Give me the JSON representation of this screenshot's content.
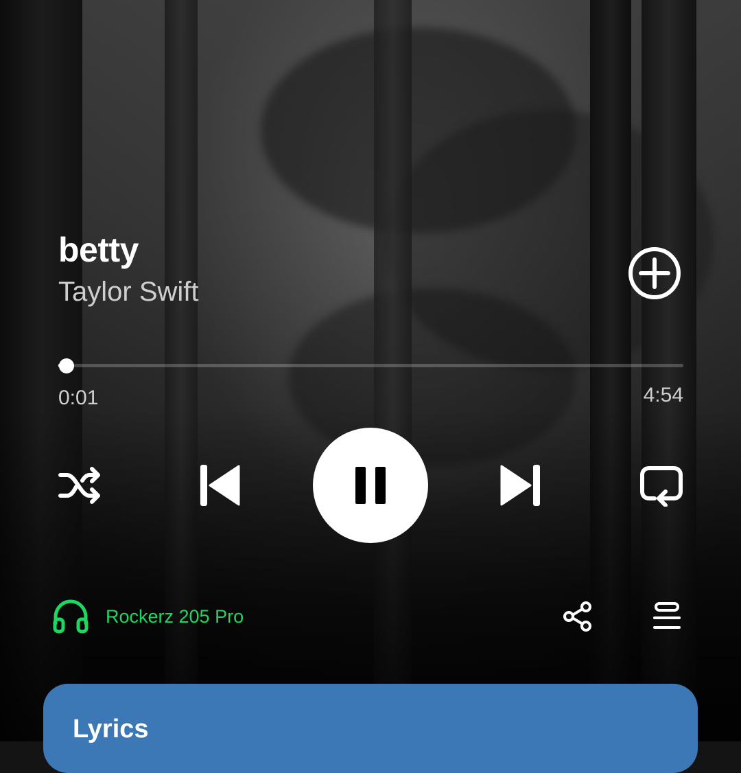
{
  "track": {
    "title": "betty",
    "artist": "Taylor Swift"
  },
  "playback": {
    "elapsed": "0:01",
    "duration": "4:54",
    "progress_fraction": 0.004,
    "state": "playing"
  },
  "controls": {
    "shuffle_icon": "shuffle-icon",
    "previous_icon": "skip-previous-icon",
    "pause_icon": "pause-icon",
    "next_icon": "skip-next-icon",
    "repeat_icon": "repeat-icon",
    "add_icon": "add-circle-icon"
  },
  "device": {
    "name": "Rockerz 205 Pro",
    "icon": "headphones-icon",
    "color": "#1ed760"
  },
  "actions": {
    "share_icon": "share-icon",
    "queue_icon": "queue-icon"
  },
  "lyrics": {
    "title": "Lyrics",
    "card_color": "#3d78b6"
  }
}
